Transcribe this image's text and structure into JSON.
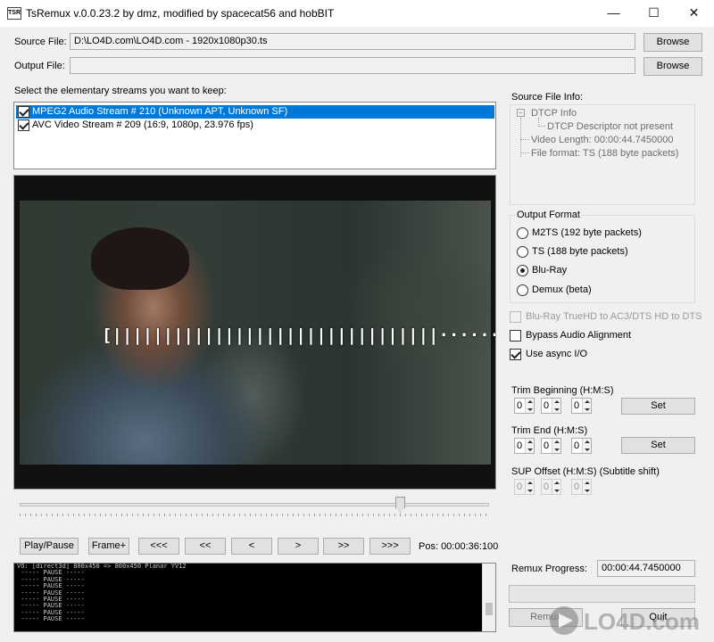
{
  "window": {
    "title": "TsRemux v.0.0.23.2 by dmz, modified by spacecat56 and hobBIT",
    "icon_text": "TSR",
    "minimize_glyph": "—",
    "maximize_glyph": "☐",
    "close_glyph": "✕"
  },
  "source": {
    "label": "Source File:",
    "value": "D:\\LO4D.com\\LO4D.com - 1920x1080p30.ts",
    "browse": "Browse"
  },
  "output": {
    "label": "Output File:",
    "value": "",
    "browse": "Browse"
  },
  "streams": {
    "label": "Select the elementary streams you want to keep:",
    "items": [
      {
        "label": "MPEG2 Audio Stream # 210 (Unknown APT, Unknown SF)",
        "checked": true,
        "selected": true
      },
      {
        "label": "AVC Video Stream # 209 (16:9, 1080p, 23.976 fps)",
        "checked": true,
        "selected": false
      }
    ]
  },
  "player": {
    "buffer_text": "[||||||||||||||||||||||||||||||||······]",
    "position_fraction": 0.81,
    "buttons": {
      "play_pause": "Play/Pause",
      "frame": "Frame+",
      "rew3": "<<<",
      "rew2": "<<",
      "rew1": "<",
      "fwd1": ">",
      "fwd2": ">>",
      "fwd3": ">>>"
    },
    "pos_label": "Pos: 00:00:36:100"
  },
  "console": {
    "lines": [
      "VO: [direct3d] 800x450 => 800x450 Planar YV12",
      " ----- PAUSE -----",
      " ----- PAUSE -----",
      " ----- PAUSE -----",
      " ----- PAUSE -----",
      " ----- PAUSE -----",
      " ----- PAUSE -----",
      " ----- PAUSE -----",
      " ----- PAUSE -----"
    ]
  },
  "source_info": {
    "label": "Source File Info:",
    "dtcp": "DTCP Info",
    "dtcp_child": "DTCP Descriptor not present",
    "video_length": "Video Length: 00:00:44.7450000",
    "file_format": "File format: TS (188 byte packets)"
  },
  "output_format": {
    "label": "Output Format",
    "options": [
      {
        "label": "M2TS (192 byte packets)",
        "checked": false
      },
      {
        "label": "TS (188 byte packets)",
        "checked": false
      },
      {
        "label": "Blu-Ray",
        "checked": true
      },
      {
        "label": "Demux (beta)",
        "checked": false
      }
    ]
  },
  "options": {
    "bluray_truehd": {
      "label": "Blu-Ray TrueHD to AC3/DTS HD to DTS",
      "checked": false,
      "disabled": true
    },
    "bypass_audio": {
      "label": "Bypass Audio Alignment",
      "checked": false
    },
    "async_io": {
      "label": "Use async I/O",
      "checked": true
    }
  },
  "trim_beginning": {
    "label": "Trim Beginning (H:M:S)",
    "h": "0",
    "m": "0",
    "s": "0",
    "set": "Set"
  },
  "trim_end": {
    "label": "Trim End (H:M:S)",
    "h": "0",
    "m": "0",
    "s": "0",
    "set": "Set"
  },
  "sup_offset": {
    "label": "SUP Offset (H:M:S) (Subtitle shift)",
    "h": "0",
    "m": "0",
    "s": "0"
  },
  "remux": {
    "progress_label": "Remux Progress:",
    "progress_value": "00:00:44.7450000",
    "progress_fraction": 0,
    "remux_button": "Remux",
    "quit_button": "Quit"
  },
  "watermark": {
    "text": "LO4D.com"
  }
}
